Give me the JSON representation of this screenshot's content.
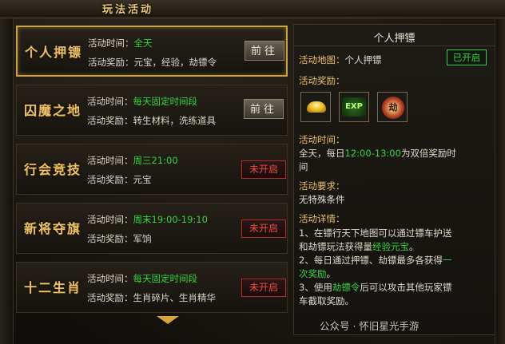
{
  "header": {
    "title": "玩法活动"
  },
  "activities": [
    {
      "name": "个人押镖",
      "time_label": "活动时间：",
      "time": "全天",
      "reward_label": "活动奖励：",
      "reward": "元宝，经验，劫镖令",
      "button": "前往"
    },
    {
      "name": "囚魔之地",
      "time_label": "活动时间：",
      "time": "每天固定时间段",
      "reward_label": "活动奖励：",
      "reward": "转生材料，洗练道具",
      "button": "前往"
    },
    {
      "name": "行会竞技",
      "time_label": "活动时间：",
      "time": "周三21:00",
      "reward_label": "活动奖励：",
      "reward": "元宝",
      "button": "未开启"
    },
    {
      "name": "新将夺旗",
      "time_label": "活动时间：",
      "time": "周末19:00-19:10",
      "reward_label": "活动奖励：",
      "reward": "军饷",
      "button": "未开启"
    },
    {
      "name": "十二生肖",
      "time_label": "活动时间：",
      "time": "每天固定时间段",
      "reward_label": "活动奖励：",
      "reward": "生肖碎片、生肖精华",
      "button": "未开启"
    }
  ],
  "detail": {
    "title": "个人押镖",
    "map_label": "活动地图：",
    "map_value": "个人押镖",
    "status": "已开启",
    "reward_label": "活动奖励：",
    "reward_icons": [
      "gold-ingot-icon",
      "exp-icon",
      "escort-token-icon"
    ],
    "reward_icon_texts": {
      "exp": "EXP",
      "seal": "劫"
    },
    "time_label": "活动时间：",
    "time_prefix": "全天，每日",
    "time_highlight": "12:00-13:00",
    "time_suffix_1": "为双倍奖励时",
    "time_suffix_2": "间",
    "requirement_label": "活动要求：",
    "requirement": "无特殊条件",
    "details_label": "活动详情：",
    "details": {
      "d1a": "1、在镖行天下地图可以通过镖车护送",
      "d1b": "和劫镖玩法获得量",
      "d1c": "经验元宝",
      "d1d": "。",
      "d2a": "2、每日通过押镖、劫镖最多各获得",
      "d2b": "一",
      "d2c": "次奖励",
      "d2d": "。",
      "d3a": "3、使用",
      "d3b": "劫镖令",
      "d3c": "后可以攻击其他玩家镖",
      "d3d": "车截取奖励。"
    }
  },
  "watermark": "公众号 · 怀旧星光手游",
  "colors": {
    "accent_gold": "#e9c16a",
    "green": "#35d43f",
    "red": "#ee4a3e"
  }
}
